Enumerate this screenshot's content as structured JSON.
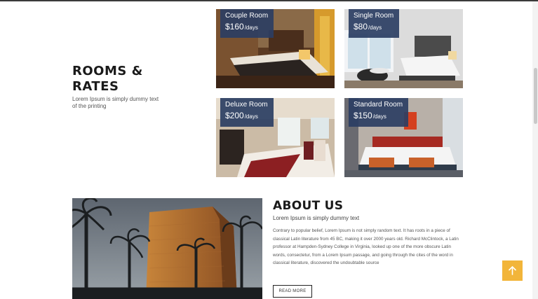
{
  "rooms": {
    "heading_line1": "ROOMS &",
    "heading_line2": "RATES",
    "subtitle": "Lorem Ipsum is simply dummy text of the printing",
    "cards": [
      {
        "name": "Couple Room",
        "price": "$160",
        "unit": "/days"
      },
      {
        "name": "Single Room",
        "price": "$80",
        "unit": "/days"
      },
      {
        "name": "Deluxe Room",
        "price": "$200",
        "unit": "/days"
      },
      {
        "name": "Standard Room",
        "price": "$150",
        "unit": "/days"
      }
    ]
  },
  "about": {
    "heading": "ABOUT US",
    "subtitle": "Lorem Ipsum is simply dummy text",
    "body": "Contrary to popular belief, Lorem Ipsum is not simply random text. It has roots in a piece of classical Latin literature from 45 BC, making it over 2000 years old. Richard McClintock, a Latin professor at Hampden-Sydney College in Virginia, looked up one of the more obscure Latin words, consectetur, from a Lorem Ipsum passage, and going through the cites of the word in classical literature, discovered the undoubtable source",
    "button_label": "READ MORE"
  },
  "colors": {
    "label_bg": "#2b3e63",
    "scroll_top_bg": "#f2b53a"
  },
  "icons": {
    "scroll_top": "arrow-up-icon"
  }
}
